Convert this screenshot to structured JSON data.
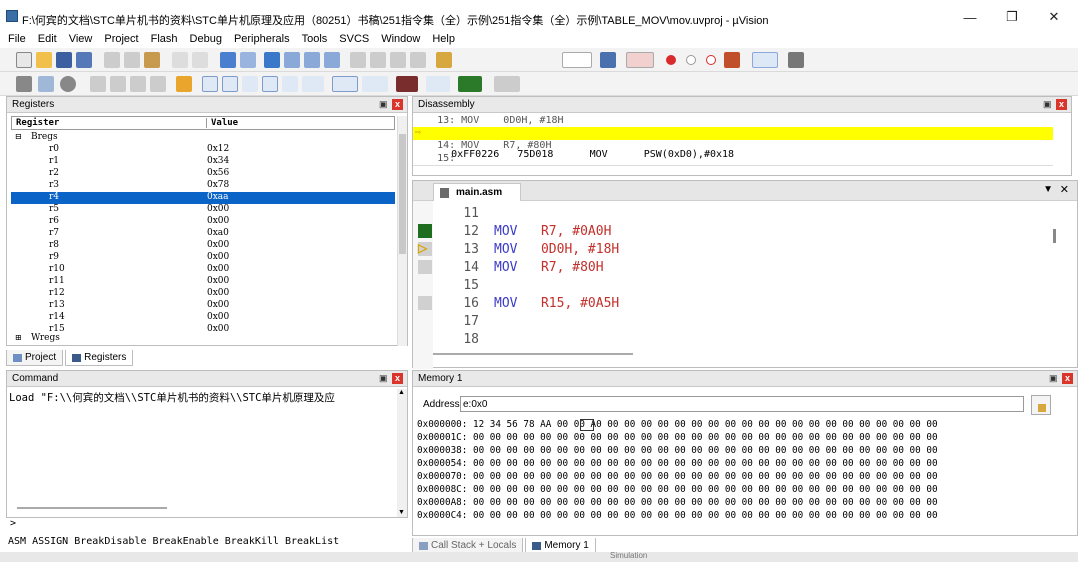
{
  "window": {
    "title": "F:\\何宾的文档\\STC单片机书的资料\\STC单片机原理及应用（80251）书稿\\251指令集（全）示例\\251指令集（全）示例\\TABLE_MOV\\mov.uvproj - µVision",
    "minimize_label": "—",
    "maximize_label": "❐",
    "close_label": "✕"
  },
  "menu": [
    "File",
    "Edit",
    "View",
    "Project",
    "Flash",
    "Debug",
    "Peripherals",
    "Tools",
    "SVCS",
    "Window",
    "Help"
  ],
  "registers_panel": {
    "title": "Registers",
    "col_register": "Register",
    "col_value": "Value",
    "group": "Bregs",
    "group2": "Wregs",
    "rows": [
      {
        "name": "r0",
        "value": "0x12"
      },
      {
        "name": "r1",
        "value": "0x34"
      },
      {
        "name": "r2",
        "value": "0x56"
      },
      {
        "name": "r3",
        "value": "0x78"
      },
      {
        "name": "r4",
        "value": "0xaa"
      },
      {
        "name": "r5",
        "value": "0x00"
      },
      {
        "name": "r6",
        "value": "0x00"
      },
      {
        "name": "r7",
        "value": "0xa0"
      },
      {
        "name": "r8",
        "value": "0x00"
      },
      {
        "name": "r9",
        "value": "0x00"
      },
      {
        "name": "r10",
        "value": "0x00"
      },
      {
        "name": "r11",
        "value": "0x00"
      },
      {
        "name": "r12",
        "value": "0x00"
      },
      {
        "name": "r13",
        "value": "0x00"
      },
      {
        "name": "r14",
        "value": "0x00"
      },
      {
        "name": "r15",
        "value": "0x00"
      }
    ],
    "selected_row": "r4",
    "tab_project": "Project",
    "tab_registers": "Registers"
  },
  "disassembly": {
    "title": "Disassembly",
    "lines": [
      "    13: MOV    0D0H, #18H",
      "0xFF0226   75D018      MOV      PSW(0xD0),#0x18",
      "    14: MOV    R7, #80H",
      "    15:"
    ]
  },
  "editor": {
    "tab": "main.asm",
    "lines": [
      {
        "n": "11",
        "op": "",
        "arg": ""
      },
      {
        "n": "12",
        "op": "MOV",
        "arg": "R7, #0A0H"
      },
      {
        "n": "13",
        "op": "MOV",
        "arg": "0D0H, #18H"
      },
      {
        "n": "14",
        "op": "MOV",
        "arg": "R7, #80H"
      },
      {
        "n": "15",
        "op": "",
        "arg": ""
      },
      {
        "n": "16",
        "op": "MOV",
        "arg": "R15, #0A5H"
      },
      {
        "n": "17",
        "op": "",
        "arg": ""
      },
      {
        "n": "18",
        "op": "",
        "arg": ""
      }
    ]
  },
  "command": {
    "title": "Command",
    "output": "Load \"F:\\\\何宾的文档\\\\STC单片机书的资料\\\\STC单片机原理及应",
    "prompt": ">",
    "help": "ASM ASSIGN BreakDisable BreakEnable BreakKill BreakList"
  },
  "memory": {
    "title": "Memory 1",
    "address_label": "Address:",
    "address_value": "e:0x0",
    "rows": [
      "0x000000: 12 34 56 78 AA 00 00 A0 00 00 00 00 00 00 00 00 00 00 00 00 00 00 00 00 00 00 00 00",
      "0x00001C: 00 00 00 00 00 00 00 00 00 00 00 00 00 00 00 00 00 00 00 00 00 00 00 00 00 00 00 00",
      "0x000038: 00 00 00 00 00 00 00 00 00 00 00 00 00 00 00 00 00 00 00 00 00 00 00 00 00 00 00 00",
      "0x000054: 00 00 00 00 00 00 00 00 00 00 00 00 00 00 00 00 00 00 00 00 00 00 00 00 00 00 00 00",
      "0x000070: 00 00 00 00 00 00 00 00 00 00 00 00 00 00 00 00 00 00 00 00 00 00 00 00 00 00 00 00",
      "0x00008C: 00 00 00 00 00 00 00 00 00 00 00 00 00 00 00 00 00 00 00 00 00 00 00 00 00 00 00 00",
      "0x0000A8: 00 00 00 00 00 00 00 00 00 00 00 00 00 00 00 00 00 00 00 00 00 00 00 00 00 00 00 00",
      "0x0000C4: 00 00 00 00 00 00 00 00 00 00 00 00 00 00 00 00 00 00 00 00 00 00 00 00 00 00 00 00"
    ],
    "tab_callstack": "Call Stack + Locals",
    "tab_memory": "Memory 1"
  },
  "status": {
    "text": "Simulation"
  },
  "colors": {
    "selection": "#0a64c8",
    "highlight": "#ffff00",
    "keyword": "#3b3bc9",
    "argument": "#c4302b"
  }
}
